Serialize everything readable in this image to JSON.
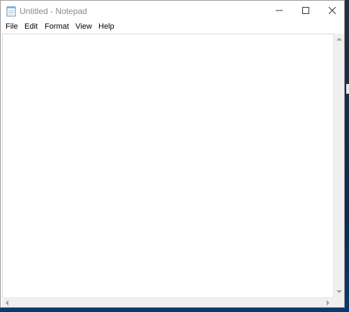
{
  "window": {
    "title": "Untitled - Notepad",
    "title_color": "#8a8a8a",
    "icon": "notepad-app-icon",
    "controls": {
      "minimize_icon": "minimize-icon",
      "maximize_icon": "maximize-icon",
      "close_icon": "close-icon"
    }
  },
  "menubar": {
    "items": [
      {
        "label": "File"
      },
      {
        "label": "Edit"
      },
      {
        "label": "Format"
      },
      {
        "label": "View"
      },
      {
        "label": "Help"
      }
    ]
  },
  "editor": {
    "content": ""
  },
  "scrollbars": {
    "vertical": {
      "up_icon": "scroll-up-icon",
      "down_icon": "scroll-down-icon"
    },
    "horizontal": {
      "left_icon": "scroll-left-icon",
      "right_icon": "scroll-right-icon"
    }
  }
}
